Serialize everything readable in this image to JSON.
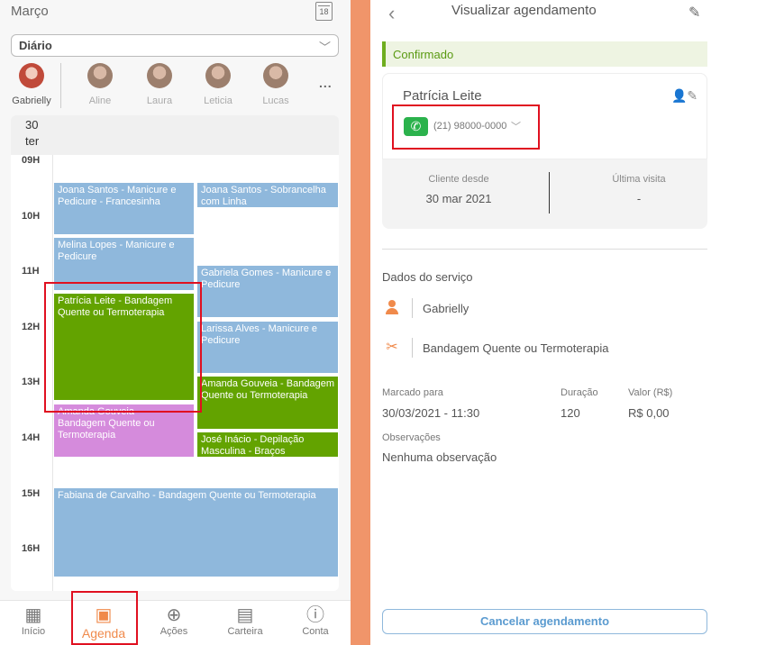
{
  "left": {
    "month": "Março",
    "calendar_day_icon": "18",
    "view_select": {
      "value": "Diário"
    },
    "professionals": [
      {
        "name": "Gabrielly",
        "selected": true
      },
      {
        "name": "Aline"
      },
      {
        "name": "Laura"
      },
      {
        "name": "Leticia"
      },
      {
        "name": "Lucas"
      }
    ],
    "more": "...",
    "day": {
      "number": "30",
      "weekday": "ter"
    },
    "hours": [
      "09H",
      "10H",
      "11H",
      "12H",
      "13H",
      "14H",
      "15H",
      "16H"
    ],
    "events": [
      {
        "text": "Joana Santos - Manicure e Pedicure - Francesinha",
        "color": "#8fb8dc"
      },
      {
        "text": "Joana Santos - Sobrancelha com Linha",
        "color": "#8fb8dc"
      },
      {
        "text": "Melina Lopes - Manicure e Pedicure",
        "color": "#8fb8dc"
      },
      {
        "text": "Gabriela Gomes - Manicure e Pedicure",
        "color": "#8fb8dc"
      },
      {
        "text": "Patrícia Leite - Bandagem Quente ou Termoterapia",
        "color": "#63a300"
      },
      {
        "text": "Larissa Alves - Manicure e Pedicure",
        "color": "#8fb8dc"
      },
      {
        "text": "Amanda Gouveia - Bandagem Quente ou Termoterapia",
        "color": "#63a300"
      },
      {
        "text": "Amanda Gouveia - Bandagem Quente ou Termoterapia",
        "color": "#d58bdc"
      },
      {
        "text": "José Inácio - Depilação Masculina - Braços",
        "color": "#63a300"
      },
      {
        "text": "Fabiana de Carvalho - Bandagem Quente ou Termoterapia",
        "color": "#8fb8dc"
      }
    ],
    "nav": [
      {
        "label": "Início",
        "icon": "grid-icon"
      },
      {
        "label": "Agenda",
        "icon": "calendar-icon",
        "active": true
      },
      {
        "label": "Ações",
        "icon": "plus-circle-icon"
      },
      {
        "label": "Carteira",
        "icon": "wallet-icon"
      },
      {
        "label": "Conta",
        "icon": "info-icon"
      }
    ]
  },
  "right": {
    "title": "Visualizar agendamento",
    "status": "Confirmado",
    "client": {
      "name": "Patrícia Leite",
      "phone": "(21) 98000-0000",
      "since_label": "Cliente desde",
      "since_value": "30 mar 2021",
      "last_visit_label": "Última visita",
      "last_visit_value": "-"
    },
    "service_section_title": "Dados do serviço",
    "professional": "Gabrielly",
    "service": "Bandagem Quente ou Termoterapia",
    "scheduled_label": "Marcado para",
    "scheduled_value": "30/03/2021 - 11:30",
    "duration_label": "Duração",
    "duration_value": "120",
    "price_label": "Valor (R$)",
    "price_value": "R$ 0,00",
    "notes_label": "Observações",
    "notes_value": "Nenhuma observação",
    "cancel_label": "Cancelar agendamento"
  },
  "colors": {
    "accent": "#f08a4b",
    "highlight": "#e01020",
    "confirmed_green": "#6fae1f",
    "whatsapp": "#2bb24c"
  }
}
